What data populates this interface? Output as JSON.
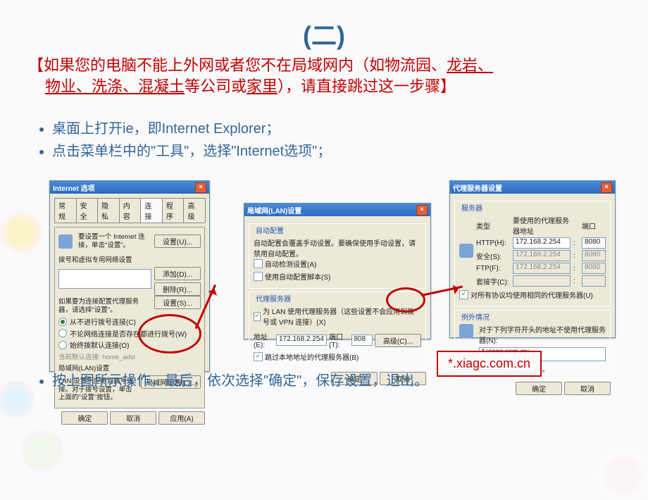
{
  "roman": "(二)",
  "notice": {
    "open": "【",
    "l1a": "如果您的电脑不能上外网或者您不在局域网内（如物流园、",
    "l1b": "龙岩、",
    "l2a": "物业、洗涤、混凝土",
    "l2b": "等公司或",
    "l2c": "家里",
    "l2d": "），请直接跳过这一步骤】"
  },
  "bullets": {
    "b1": "桌面上打开ie，即Internet Explorer；",
    "b2": "点击菜单栏中的\"工具\"，选择\"Internet选项\"；"
  },
  "bottom": "按上图所示操作，最后，依次选择\"确定\"，保存设置，退出。",
  "dlg1": {
    "title": "Internet 选项",
    "tabs": [
      "常规",
      "安全",
      "隐私",
      "内容",
      "连接",
      "程序",
      "高级"
    ],
    "setup_text": "要设置一个 Internet 连接，单击\"设置\"。",
    "setup_btn": "设置(U)...",
    "section1": "拨号和虚拟专用网络设置",
    "add_btn": "添加(D)...",
    "remove_btn": "删除(R)...",
    "info2": "如果要为连接配置代理服务器，请选择\"设置\"。",
    "settings_btn": "设置(S)...",
    "r1": "从不进行拨号连接(C)",
    "r2": "不论网络连接是否存在都进行拨号(W)",
    "r3": "始终拨默认连接(O)",
    "default_label": "当前默认连接:",
    "default_val": "home_adsl",
    "section2": "局域网(LAN)设置",
    "lan_text": "LAN 设置不应用到拨号连接。对于拨号设置，单击上面的\"设置\"按钮。",
    "lan_btn": "局域网设置(L)...",
    "ok": "确定",
    "cancel": "取消",
    "apply": "应用(A)"
  },
  "dlg2": {
    "title": "局域网(LAN)设置",
    "group1": "自动配置",
    "g1_text": "自动配置会覆盖手动设置。要确保使用手动设置，请禁用自动配置。",
    "c1": "自动检测设置(A)",
    "c2": "使用自动配置脚本(S)",
    "group2": "代理服务器",
    "c3": "为 LAN 使用代理服务器（这些设置不会应用到拨号或 VPN 连接）(X)",
    "addr_label": "地址(E):",
    "addr_val": "172.168.2.254",
    "port_label": "端口(T):",
    "port_val": "808",
    "adv_btn": "高级(C)...",
    "c4": "跳过本地地址的代理服务器(B)",
    "ok": "确定",
    "cancel": "取消"
  },
  "dlg3": {
    "title": "代理服务器设置",
    "group1": "服务器",
    "col_type": "类型",
    "col_addr": "要使用的代理服务器地址",
    "col_port": "端口",
    "rows": {
      "http_lbl": "HTTP(H):",
      "http_addr": "172.168.2.254",
      "http_port": "8080",
      "sec_lbl": "安全(S):",
      "sec_addr": "172.168.2.254",
      "sec_port": "8080",
      "ftp_lbl": "FTP(F):",
      "ftp_addr": "172.168.2.254",
      "ftp_port": "8080",
      "sock_lbl": "套接字(C):",
      "sock_addr": "",
      "sock_port": ""
    },
    "same_chk": "对所有协议均使用相同的代理服务器(U)",
    "group2": "例外情况",
    "g2_text": "对于下列字符开头的地址不使用代理服务器(N):",
    "excl_val": "*.xiagc.com.cn;",
    "g2_hint": "使用分号(;)分隔各项。",
    "ok": "确定",
    "cancel": "取消"
  },
  "overlay": "*.xiagc.com.cn"
}
